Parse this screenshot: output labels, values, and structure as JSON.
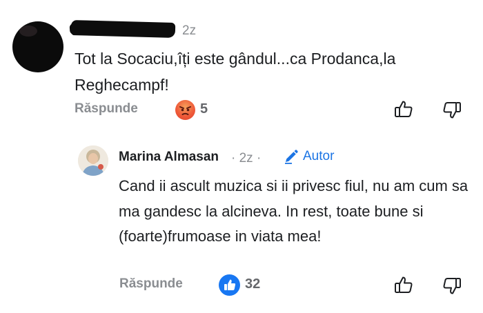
{
  "comment": {
    "time": "2z",
    "text": "Tot la Socaciu,îți este gândul...ca Prodanca,la Reghecampf!",
    "reply_label": "Răspunde",
    "reaction_icon": "angry-face-icon",
    "reaction_count": "5"
  },
  "reply": {
    "author": "Marina Almasan",
    "meta": "· 2z ·",
    "author_badge": "Autor",
    "text": "Cand ii ascult muzica si ii privesc fiul,  nu am cum sa ma gandesc la alcineva. In rest, toate bune si (foarte)frumoase in viata mea!",
    "reply_label": "Răspunde",
    "reaction_icon": "like-thumb-icon",
    "reaction_count": "32"
  },
  "colors": {
    "meta_gray": "#8a8d91",
    "link_blue": "#1b74e4",
    "like_blue": "#1877f2",
    "angry_orange": "#ef5b3a"
  }
}
